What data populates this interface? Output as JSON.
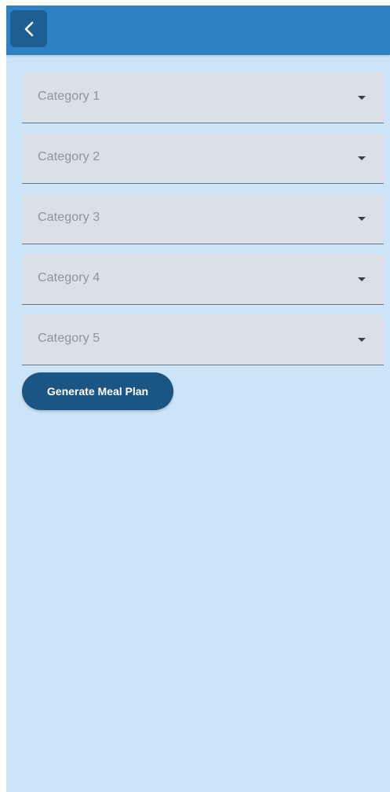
{
  "appbar": {
    "back_icon": "chevron-left-icon",
    "color": "#2e81c4"
  },
  "form": {
    "categories": [
      {
        "label": "Category 1"
      },
      {
        "label": "Category 2"
      },
      {
        "label": "Category 3"
      },
      {
        "label": "Category 4"
      },
      {
        "label": "Category 5"
      }
    ],
    "dropdown_icon": "dropdown-arrow-icon"
  },
  "actions": {
    "generate_label": "Generate Meal Plan",
    "button_color": "#1a5584"
  },
  "theme": {
    "background": "#cce4f7",
    "field_background": "#d9e0e8"
  }
}
